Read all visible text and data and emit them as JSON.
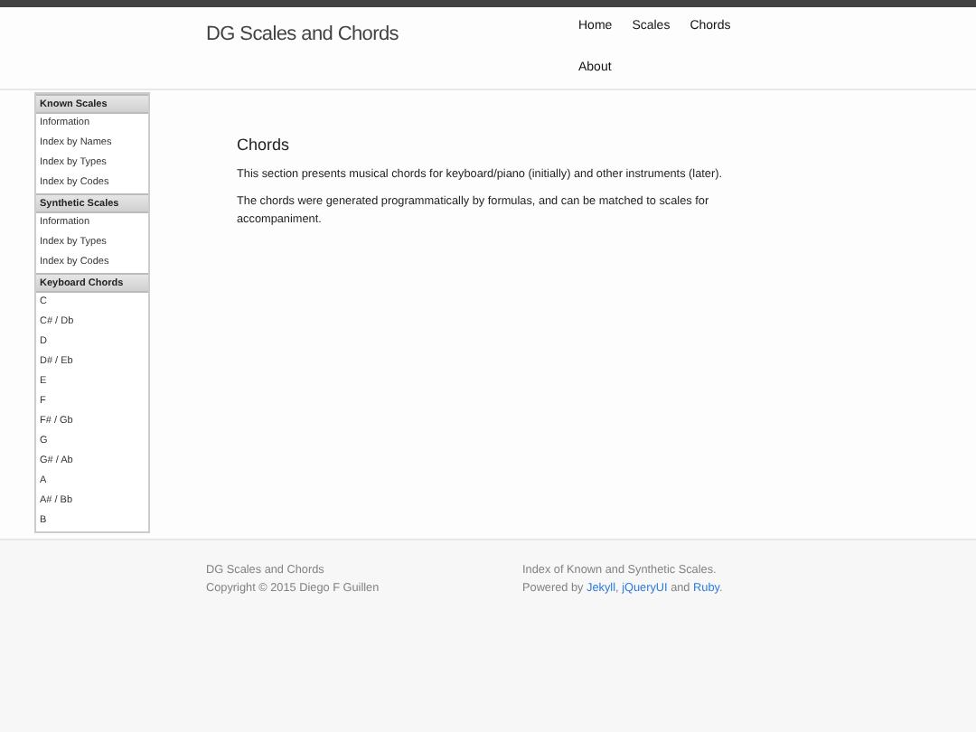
{
  "header": {
    "title": "DG Scales and Chords",
    "nav": [
      {
        "label": "Home"
      },
      {
        "label": "Scales"
      },
      {
        "label": "Chords"
      },
      {
        "label": "About"
      }
    ]
  },
  "sidebar": {
    "groups": [
      {
        "title": "Known Scales",
        "items": [
          "Information",
          "Index by Names",
          "Index by Types",
          "Index by Codes"
        ]
      },
      {
        "title": "Synthetic Scales",
        "items": [
          "Information",
          "Index by Types",
          "Index by Codes"
        ]
      },
      {
        "title": "Keyboard Chords",
        "items": [
          "C",
          "C# / Db",
          "D",
          "D# / Eb",
          "E",
          "F",
          "F# / Gb",
          "G",
          "G# / Ab",
          "A",
          "A# / Bb",
          "B"
        ]
      }
    ]
  },
  "main": {
    "heading": "Chords",
    "paragraphs": [
      "This section presents musical chords for keyboard/piano (initially) and other instruments (later).",
      "The chords were generated programmatically by formulas, and can be matched to scales for accompaniment."
    ]
  },
  "footer": {
    "left": [
      "DG Scales and Chords",
      "Copyright © 2015 Diego F Guillen"
    ],
    "right_line": "Index of Known and Synthetic Scales.",
    "powered": {
      "prefix": "Powered by",
      "links": [
        {
          "text": "Jekyll",
          "after": ","
        },
        {
          "text": "jQueryUI",
          "after": " and"
        },
        {
          "text": "Ruby",
          "after": "."
        }
      ]
    }
  }
}
